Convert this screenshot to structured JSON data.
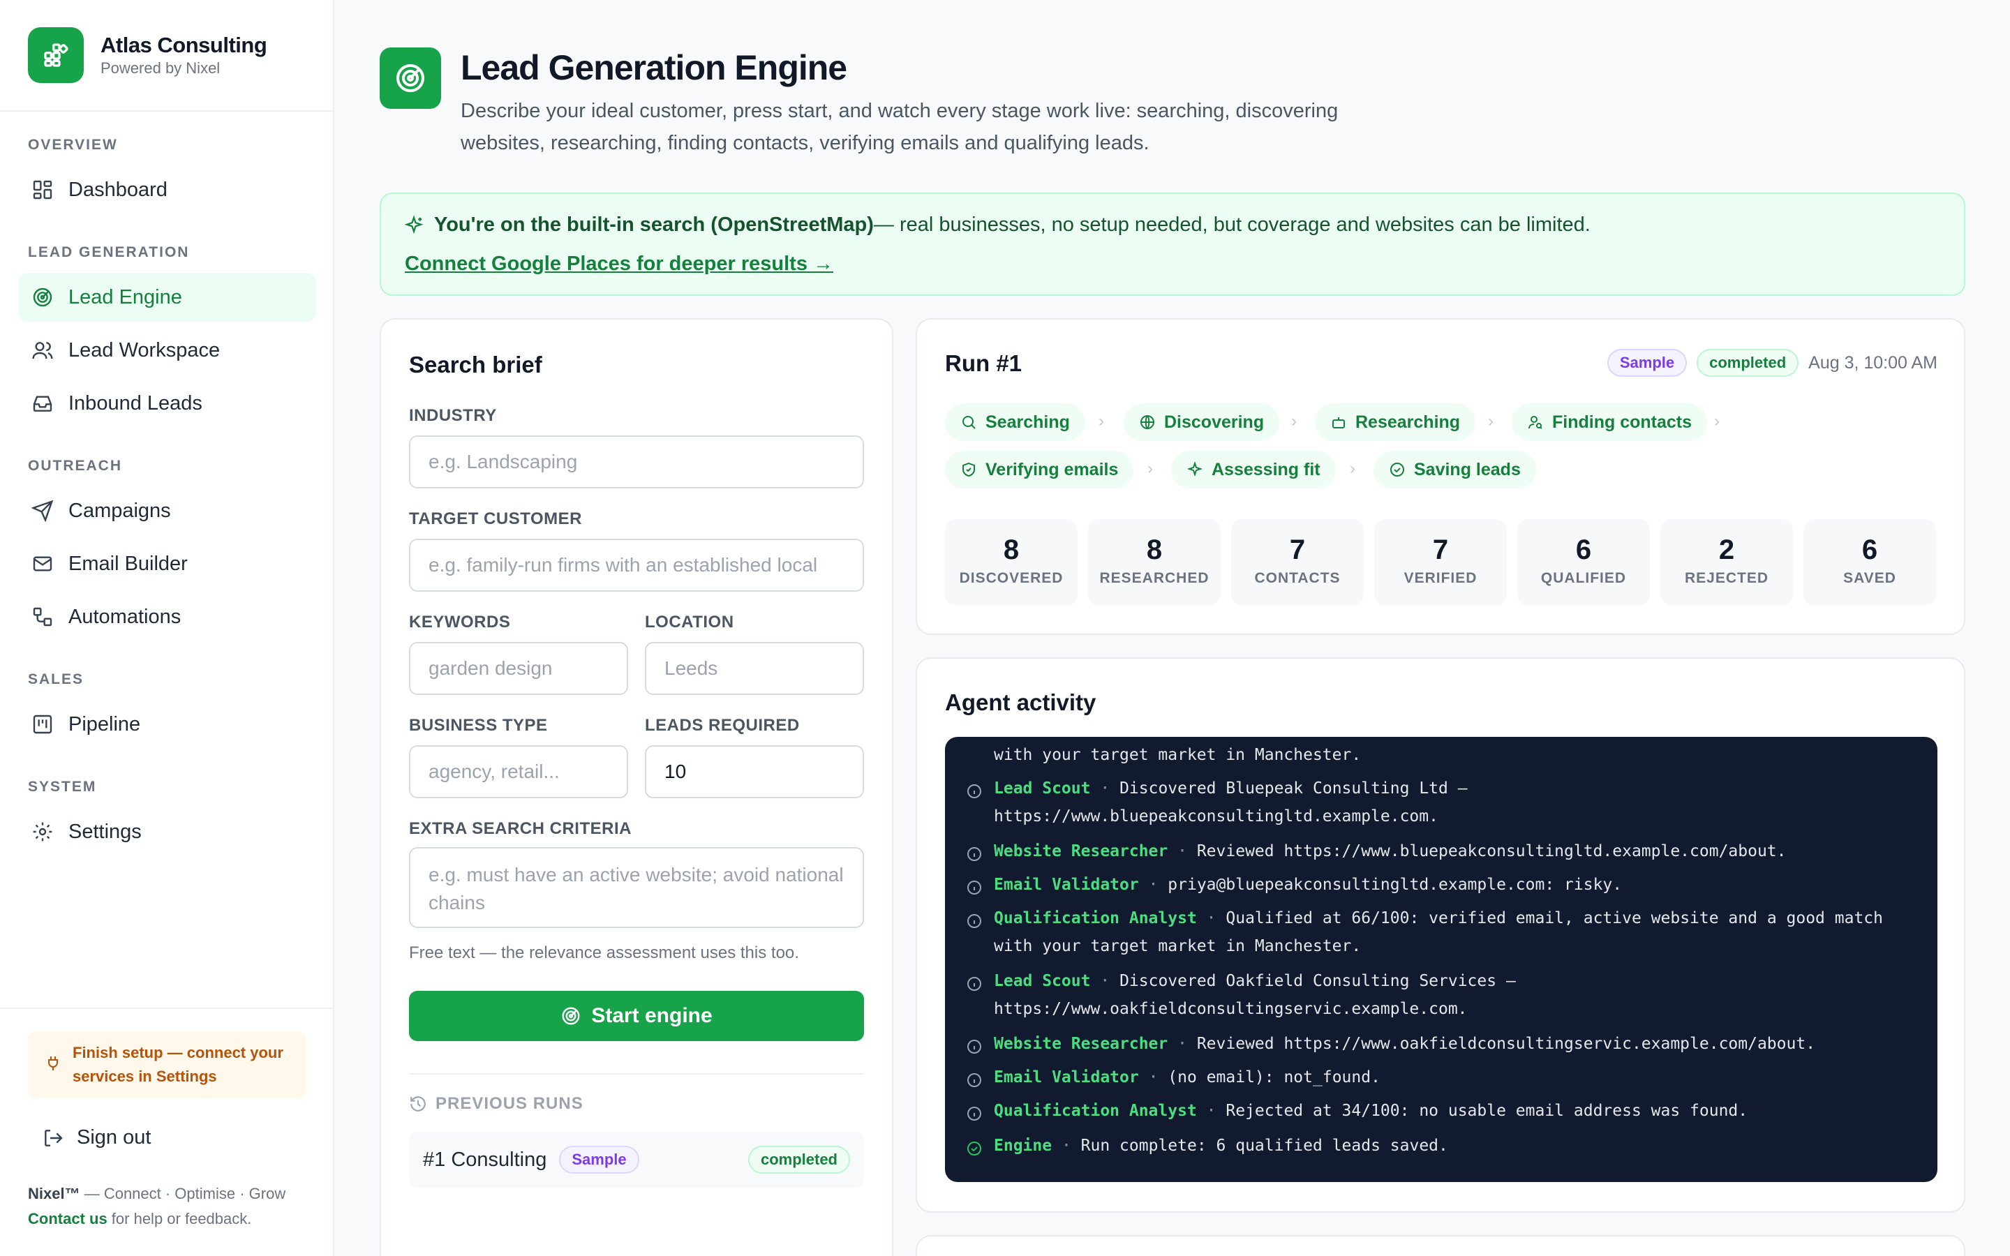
{
  "brand": {
    "name": "Atlas Consulting",
    "sub": "Powered by Nixel"
  },
  "nav": {
    "overview_label": "OVERVIEW",
    "dashboard": "Dashboard",
    "leadgen_label": "LEAD GENERATION",
    "lead_engine": "Lead Engine",
    "lead_workspace": "Lead Workspace",
    "inbound_leads": "Inbound Leads",
    "outreach_label": "OUTREACH",
    "campaigns": "Campaigns",
    "email_builder": "Email Builder",
    "automations": "Automations",
    "sales_label": "SALES",
    "pipeline": "Pipeline",
    "system_label": "SYSTEM",
    "settings": "Settings"
  },
  "setup_notice": {
    "line1": "Finish setup — connect your",
    "line2": "services in Settings"
  },
  "signout": "Sign out",
  "footer": {
    "brand": "Nixel™",
    "tagline": " — Connect · Optimise · Grow",
    "contact_link": "Contact us",
    "contact_rest": " for help or feedback."
  },
  "header": {
    "title": "Lead Generation Engine",
    "desc_line1": "Describe your ideal customer, press start, and watch every stage work live: searching, discovering",
    "desc_line2": "websites, researching, finding contacts, verifying emails and qualifying leads."
  },
  "banner": {
    "bold": "You're on the built-in search (OpenStreetMap)",
    "rest": " — real businesses, no setup needed, but coverage and websites can be limited.",
    "link": "Connect Google Places for deeper results →"
  },
  "search": {
    "title": "Search brief",
    "industry_label": "INDUSTRY",
    "industry_placeholder": "e.g. Landscaping",
    "target_label": "TARGET CUSTOMER",
    "target_placeholder": "e.g. family-run firms with an established local",
    "keywords_label": "KEYWORDS",
    "keywords_placeholder": "garden design",
    "location_label": "LOCATION",
    "location_placeholder": "Leeds",
    "business_label": "BUSINESS TYPE",
    "business_placeholder": "agency, retail...",
    "leads_label": "LEADS REQUIRED",
    "leads_value": "10",
    "extra_label": "EXTRA SEARCH CRITERIA",
    "extra_placeholder": "e.g. must have an active website; avoid national chains",
    "hint": "Free text — the relevance assessment uses this too.",
    "start_button": "Start engine",
    "previous_label": "PREVIOUS RUNS",
    "previous_runs": [
      {
        "name": "#1 Consulting",
        "tag": "Sample",
        "status": "completed"
      }
    ]
  },
  "run": {
    "title": "Run #1",
    "tag": "Sample",
    "status": "completed",
    "time": "Aug 3, 10:00 AM",
    "stages": [
      "Searching",
      "Discovering",
      "Researching",
      "Finding contacts",
      "Verifying emails",
      "Assessing fit",
      "Saving leads"
    ],
    "stats": [
      {
        "value": "8",
        "label": "DISCOVERED"
      },
      {
        "value": "8",
        "label": "RESEARCHED"
      },
      {
        "value": "7",
        "label": "CONTACTS"
      },
      {
        "value": "7",
        "label": "VERIFIED"
      },
      {
        "value": "6",
        "label": "QUALIFIED"
      },
      {
        "value": "2",
        "label": "REJECTED"
      },
      {
        "value": "6",
        "label": "SAVED"
      }
    ]
  },
  "activity": {
    "title": "Agent activity",
    "partial_line": "with your target market in Manchester.",
    "entries": [
      {
        "agent": "Lead Scout",
        "text": "Discovered Bluepeak Consulting Ltd —",
        "cont": "https://www.bluepeakconsultingltd.example.com.",
        "icon": "info"
      },
      {
        "agent": "Website Researcher",
        "text": "Reviewed https://www.bluepeakconsultingltd.example.com/about.",
        "icon": "info"
      },
      {
        "agent": "Email Validator",
        "text": "priya@bluepeakconsultingltd.example.com: risky.",
        "icon": "info"
      },
      {
        "agent": "Qualification Analyst",
        "text": "Qualified at 66/100: verified email, active website and a good match",
        "cont": "with your target market in Manchester.",
        "icon": "info"
      },
      {
        "agent": "Lead Scout",
        "text": "Discovered Oakfield Consulting Services —",
        "cont": "https://www.oakfieldconsultingservic.example.com.",
        "icon": "info"
      },
      {
        "agent": "Website Researcher",
        "text": "Reviewed https://www.oakfieldconsultingservic.example.com/about.",
        "icon": "info"
      },
      {
        "agent": "Email Validator",
        "text": "(no email): not_found.",
        "icon": "info"
      },
      {
        "agent": "Qualification Analyst",
        "text": "Rejected at 34/100: no usable email address was found.",
        "icon": "info"
      },
      {
        "agent": "Engine",
        "text": "Run complete: 6 qualified leads saved.",
        "icon": "check"
      }
    ]
  },
  "colors": {
    "accent": "#16a34a",
    "accent_dark": "#15803d",
    "log_bg": "#111a2e",
    "warn": "#b45309"
  }
}
